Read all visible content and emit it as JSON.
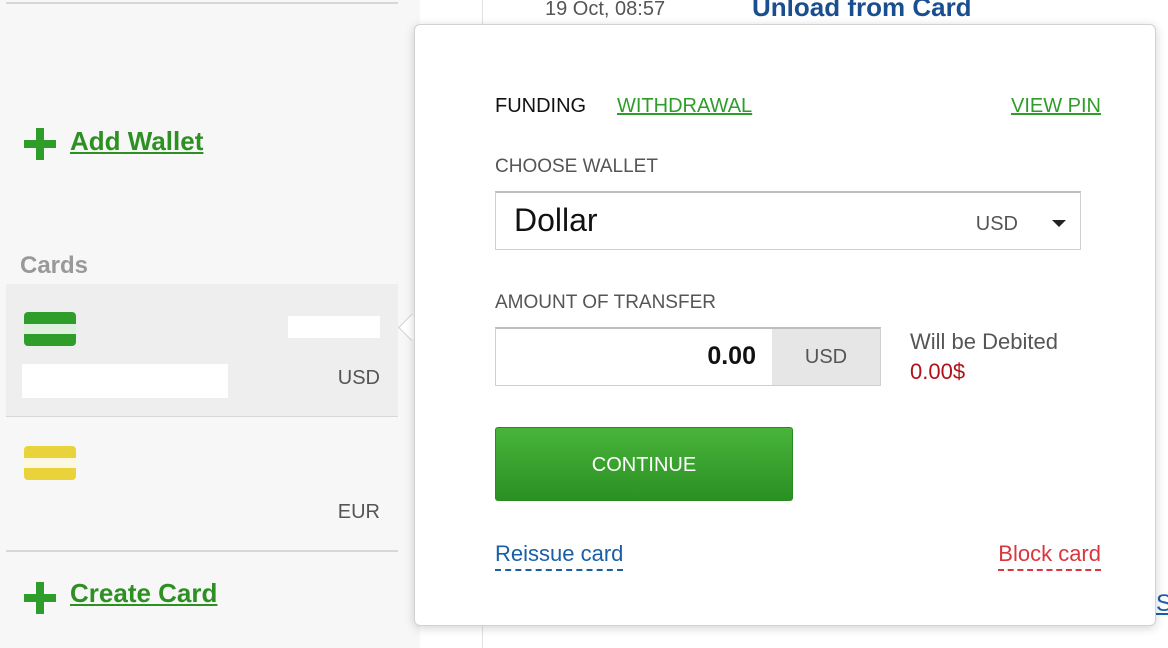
{
  "background": {
    "transaction_date": "19 Oct, 08:57",
    "transaction_title": "Unload from Card",
    "edge_link_fragment": "S"
  },
  "sidebar": {
    "add_wallet_label": "Add Wallet",
    "cards_heading": "Cards",
    "cards": [
      {
        "currency": "USD",
        "color": "#2e9d2a"
      },
      {
        "currency": "EUR",
        "color": "#e9d23a"
      }
    ],
    "create_card_label": "Create Card"
  },
  "popup": {
    "tabs": {
      "funding": "FUNDING",
      "withdrawal": "WITHDRAWAL"
    },
    "view_pin": "VIEW PIN",
    "choose_wallet_label": "CHOOSE WALLET",
    "wallet": {
      "name": "Dollar",
      "currency": "USD"
    },
    "amount_label": "AMOUNT OF TRANSFER",
    "amount": {
      "value": "0.00",
      "currency": "USD"
    },
    "debit": {
      "label": "Will be Debited",
      "amount": "0.00$"
    },
    "continue_label": "CONTINUE",
    "reissue_label": "Reissue card",
    "block_label": "Block card"
  },
  "colors": {
    "accent_green": "#2e9d2a",
    "link_blue": "#1a5fa6",
    "danger_red": "#d9363e",
    "debit_red": "#b0121b"
  },
  "icons": [
    "plus-icon",
    "card-icon",
    "chevron-down-icon"
  ]
}
